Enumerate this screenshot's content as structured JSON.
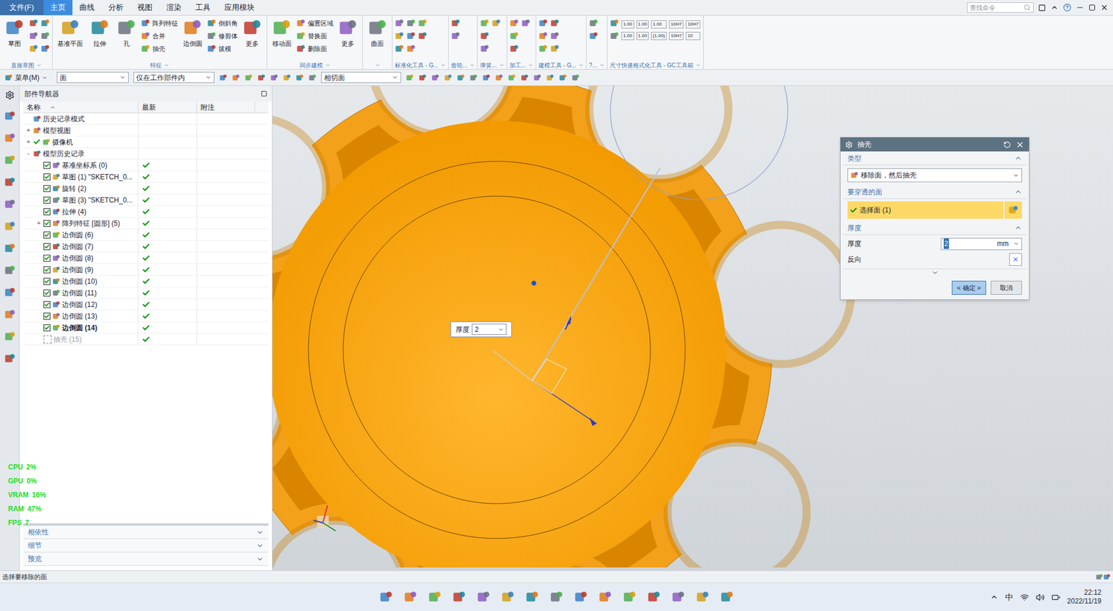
{
  "window": {
    "file_menu": "文件(F)",
    "search_placeholder": "查找命令"
  },
  "tabs": [
    {
      "label": "主页",
      "selected": true
    },
    {
      "label": "曲线",
      "selected": false
    },
    {
      "label": "分析",
      "selected": false
    },
    {
      "label": "视图",
      "selected": false
    },
    {
      "label": "渲染",
      "selected": false
    },
    {
      "label": "工具",
      "selected": false
    },
    {
      "label": "应用模块",
      "selected": false
    }
  ],
  "ribbon": [
    {
      "label": "直接草图",
      "items": [
        {
          "label": "草图",
          "kind": "big"
        },
        {
          "label": "",
          "kind": "icon"
        },
        {
          "label": "",
          "kind": "icon"
        },
        {
          "label": "",
          "kind": "icon"
        },
        {
          "label": "",
          "kind": "icon"
        },
        {
          "label": "",
          "kind": "icon"
        },
        {
          "label": "",
          "kind": "icon"
        }
      ]
    },
    {
      "label": "特征",
      "items": [
        {
          "label": "基准平面",
          "kind": "big"
        },
        {
          "label": "拉伸",
          "kind": "big"
        },
        {
          "label": "孔",
          "kind": "big"
        },
        {
          "label": "阵列特征",
          "kind": "small"
        },
        {
          "label": "合并",
          "kind": "small"
        },
        {
          "label": "抽壳",
          "kind": "small"
        },
        {
          "label": "边倒圆",
          "kind": "big"
        },
        {
          "label": "倒斜角",
          "kind": "small"
        },
        {
          "label": "修剪体",
          "kind": "small"
        },
        {
          "label": "拔模",
          "kind": "small"
        },
        {
          "label": "更多",
          "kind": "big"
        }
      ]
    },
    {
      "label": "同步建模",
      "items": [
        {
          "label": "移动面",
          "kind": "big"
        },
        {
          "label": "偏置区域",
          "kind": "small"
        },
        {
          "label": "替换面",
          "kind": "small"
        },
        {
          "label": "删除面",
          "kind": "small"
        },
        {
          "label": "更多",
          "kind": "big"
        }
      ]
    },
    {
      "label": "",
      "items": [
        {
          "label": "曲面",
          "kind": "big"
        }
      ]
    },
    {
      "label": "标准化工具 - G...",
      "items": [
        {
          "label": "",
          "kind": "icon"
        },
        {
          "label": "",
          "kind": "icon"
        },
        {
          "label": "",
          "kind": "icon"
        },
        {
          "label": "",
          "kind": "icon"
        },
        {
          "label": "",
          "kind": "icon"
        },
        {
          "label": "",
          "kind": "icon"
        },
        {
          "label": "",
          "kind": "icon"
        },
        {
          "label": "",
          "kind": "icon"
        }
      ]
    },
    {
      "label": "齿轮...",
      "items": [
        {
          "label": "",
          "kind": "icon"
        },
        {
          "label": "",
          "kind": "icon"
        }
      ]
    },
    {
      "label": "弹簧...",
      "items": [
        {
          "label": "",
          "kind": "icon"
        },
        {
          "label": "",
          "kind": "icon"
        },
        {
          "label": "",
          "kind": "icon"
        },
        {
          "label": "",
          "kind": "icon"
        }
      ]
    },
    {
      "label": "加工...",
      "items": [
        {
          "label": "",
          "kind": "icon"
        },
        {
          "label": "",
          "kind": "icon"
        },
        {
          "label": "",
          "kind": "icon"
        },
        {
          "label": "",
          "kind": "icon"
        }
      ]
    },
    {
      "label": "建模工具 - G...",
      "items": [
        {
          "label": "",
          "kind": "icon"
        },
        {
          "label": "",
          "kind": "icon"
        },
        {
          "label": "",
          "kind": "icon"
        },
        {
          "label": "",
          "kind": "icon"
        },
        {
          "label": "",
          "kind": "icon"
        },
        {
          "label": "",
          "kind": "icon"
        }
      ]
    },
    {
      "label": "?...",
      "items": [
        {
          "label": "",
          "kind": "icon"
        },
        {
          "label": "",
          "kind": "icon"
        }
      ]
    },
    {
      "label": "尺寸快速格式化工具 - GC工具箱",
      "items": [
        {
          "label": "",
          "kind": "icon"
        },
        {
          "label": "",
          "kind": "icon"
        },
        {
          "label": "1.00",
          "kind": "tag"
        },
        {
          "label": "1.00",
          "kind": "tag"
        },
        {
          "label": "1.00",
          "kind": "tag"
        },
        {
          "label": "1.00",
          "kind": "tag"
        },
        {
          "label": "1.00",
          "kind": "tag"
        },
        {
          "label": "(1.00)",
          "kind": "tag"
        },
        {
          "label": "10H7",
          "kind": "tag"
        },
        {
          "label": "10H7",
          "kind": "tag"
        },
        {
          "label": "10H7",
          "kind": "tag"
        },
        {
          "label": "10",
          "kind": "tag"
        }
      ]
    }
  ],
  "toolbar": {
    "menu": "菜单(M)",
    "filters": [
      "面",
      "仅在工作部件内"
    ],
    "face_rule": "相切面"
  },
  "navigator": {
    "title": "部件导航器",
    "columns": [
      "名称",
      "最新",
      "附注"
    ],
    "items": [
      {
        "label": "历史记录模式",
        "level": 0,
        "expander": "",
        "box": false,
        "checked": false,
        "latest": false,
        "bold": false,
        "disabled": false
      },
      {
        "label": "模型视图",
        "level": 0,
        "expander": "+",
        "box": false,
        "checked": false,
        "latest": false,
        "bold": false,
        "disabled": false
      },
      {
        "label": "摄像机",
        "level": 0,
        "expander": "+",
        "box": false,
        "checked": true,
        "latest": false,
        "bold": false,
        "disabled": false
      },
      {
        "label": "模型历史记录",
        "level": 0,
        "expander": "-",
        "box": false,
        "checked": false,
        "latest": false,
        "bold": false,
        "disabled": false
      },
      {
        "label": "基准坐标系 (0)",
        "level": 1,
        "expander": "",
        "box": true,
        "checked": true,
        "latest": true,
        "bold": false,
        "disabled": false
      },
      {
        "label": "草图 (1) \"SKETCH_0...",
        "level": 1,
        "expander": "",
        "box": true,
        "checked": true,
        "latest": true,
        "bold": false,
        "disabled": false
      },
      {
        "label": "旋转 (2)",
        "level": 1,
        "expander": "",
        "box": true,
        "checked": true,
        "latest": true,
        "bold": false,
        "disabled": false
      },
      {
        "label": "草图 (3) \"SKETCH_0...",
        "level": 1,
        "expander": "",
        "box": true,
        "checked": true,
        "latest": true,
        "bold": false,
        "disabled": false
      },
      {
        "label": "拉伸 (4)",
        "level": 1,
        "expander": "",
        "box": true,
        "checked": true,
        "latest": true,
        "bold": false,
        "disabled": false
      },
      {
        "label": "阵列特征 [圆形] (5)",
        "level": 1,
        "expander": "+",
        "box": true,
        "checked": true,
        "latest": true,
        "bold": false,
        "disabled": false
      },
      {
        "label": "边倒圆 (6)",
        "level": 1,
        "expander": "",
        "box": true,
        "checked": true,
        "latest": true,
        "bold": false,
        "disabled": false
      },
      {
        "label": "边倒圆 (7)",
        "level": 1,
        "expander": "",
        "box": true,
        "checked": true,
        "latest": true,
        "bold": false,
        "disabled": false
      },
      {
        "label": "边倒圆 (8)",
        "level": 1,
        "expander": "",
        "box": true,
        "checked": true,
        "latest": true,
        "bold": false,
        "disabled": false
      },
      {
        "label": "边倒圆 (9)",
        "level": 1,
        "expander": "",
        "box": true,
        "checked": true,
        "latest": true,
        "bold": false,
        "disabled": false
      },
      {
        "label": "边倒圆 (10)",
        "level": 1,
        "expander": "",
        "box": true,
        "checked": true,
        "latest": true,
        "bold": false,
        "disabled": false
      },
      {
        "label": "边倒圆 (11)",
        "level": 1,
        "expander": "",
        "box": true,
        "checked": true,
        "latest": true,
        "bold": false,
        "disabled": false
      },
      {
        "label": "边倒圆 (12)",
        "level": 1,
        "expander": "",
        "box": true,
        "checked": true,
        "latest": true,
        "bold": false,
        "disabled": false
      },
      {
        "label": "边倒圆 (13)",
        "level": 1,
        "expander": "",
        "box": true,
        "checked": true,
        "latest": true,
        "bold": false,
        "disabled": false
      },
      {
        "label": "边倒圆 (14)",
        "level": 1,
        "expander": "",
        "box": true,
        "checked": true,
        "latest": true,
        "bold": true,
        "disabled": false
      },
      {
        "label": "抽壳 (15)",
        "level": 1,
        "expander": "",
        "box": false,
        "checked": false,
        "latest": true,
        "bold": false,
        "disabled": true
      }
    ],
    "panels": [
      "相依性",
      "细节",
      "预览"
    ]
  },
  "perf": [
    {
      "label": "CPU",
      "value": "2%"
    },
    {
      "label": "GPU",
      "value": "0%"
    },
    {
      "label": "VRAM",
      "value": "16%"
    },
    {
      "label": "RAM",
      "value": "47%"
    },
    {
      "label": "FPS",
      "value": "7"
    }
  ],
  "viewport": {
    "thickness_label": "厚度",
    "thickness_value": "2"
  },
  "dialog": {
    "title": "抽壳",
    "type_section": "类型",
    "type_value": "移除面，然后抽壳",
    "faces_section": "要穿透的面",
    "faces_value": "选择面 (1)",
    "faces_selected": true,
    "thickness_section": "厚度",
    "thickness_label": "厚度",
    "thickness_value": "2",
    "unit": "mm",
    "reverse_label": "反向",
    "ok": "< 确定 >",
    "cancel": "取消"
  },
  "status_bar": "选择要移除的面",
  "taskbar": {
    "ime": "中",
    "time": "22:12",
    "date": "2022/11/19"
  }
}
